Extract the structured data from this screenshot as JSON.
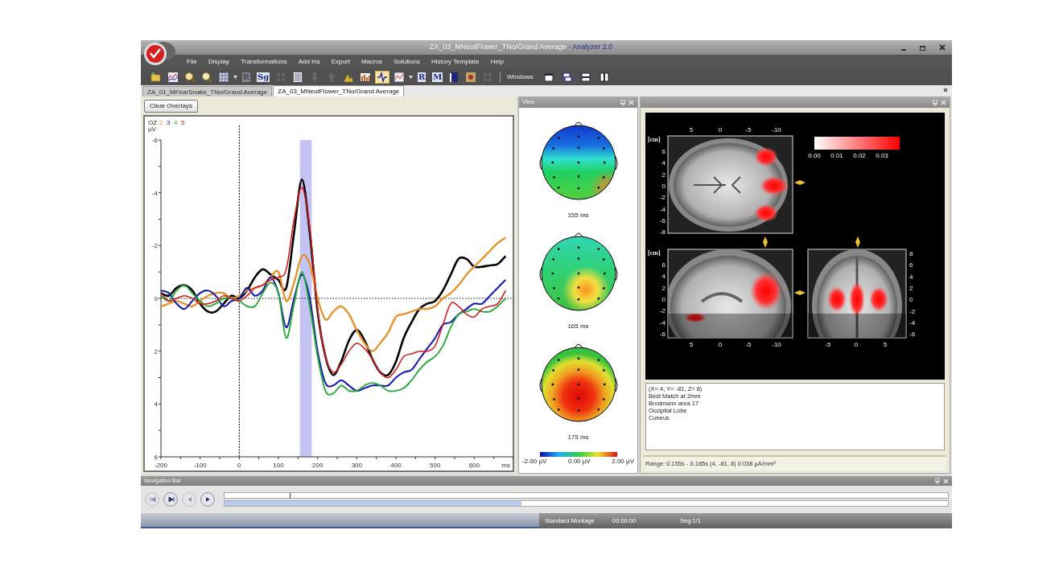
{
  "window": {
    "title": "ZA_03_MNeutFlower_TNo/Grand Average",
    "app_name": " - Analyzer 2.0"
  },
  "menu": [
    "File",
    "Display",
    "Transformations",
    "Add Ins",
    "Export",
    "Macros",
    "Solutions",
    "History Template",
    "Help"
  ],
  "toolbar": {
    "buttons": [
      {
        "disabled": false,
        "selected": false
      },
      {
        "disabled": false,
        "selected": false
      },
      {
        "disabled": false,
        "selected": false
      },
      {
        "disabled": false,
        "selected": false
      },
      {
        "disabled": false,
        "selected": false,
        "dropdown": true
      },
      {
        "disabled": true,
        "selected": false,
        "glyph": "R"
      },
      {
        "disabled": false,
        "selected": false,
        "glyph": "Sg"
      },
      {
        "disabled": true,
        "selected": false
      },
      {
        "disabled": false,
        "selected": false
      },
      {
        "disabled": true,
        "selected": false
      },
      {
        "disabled": true,
        "selected": false
      },
      {
        "disabled": false,
        "selected": false
      },
      {
        "disabled": false,
        "selected": false
      },
      {
        "disabled": false,
        "selected": true
      },
      {
        "disabled": false,
        "selected": false,
        "dropdown": true
      },
      {
        "disabled": false,
        "selected": false,
        "glyph": "R"
      },
      {
        "disabled": false,
        "selected": false,
        "glyph": "M"
      },
      {
        "disabled": false,
        "selected": false
      },
      {
        "disabled": false,
        "selected": false
      },
      {
        "disabled": true,
        "selected": false
      }
    ],
    "windows_label": "Windows"
  },
  "tabs": [
    {
      "label": "ZA_01_MFearSnake_TNo/Grand Average",
      "selected": false
    },
    {
      "label": "ZA_03_MNeutFlower_TNo/Grand Average",
      "selected": true
    }
  ],
  "clear_overlays_button": "Clear Overlays",
  "erp_chart": {
    "chart_data": {
      "type": "line",
      "title": "OZ",
      "xlabel": "ms",
      "ylabel": "µV",
      "bands": [
        {
          "axis": "x",
          "from": 155,
          "to": 185
        }
      ],
      "ref_lines": [
        {
          "axis": "x",
          "value": 0
        },
        {
          "axis": "y",
          "value": 0
        }
      ],
      "x": [
        -200,
        -180,
        -160,
        -140,
        -120,
        -100,
        -80,
        -60,
        -40,
        -20,
        0,
        20,
        40,
        60,
        80,
        100,
        120,
        140,
        160,
        180,
        200,
        220,
        240,
        260,
        280,
        300,
        320,
        340,
        360,
        380,
        400,
        420,
        440,
        460,
        480,
        500,
        520,
        540,
        560,
        580,
        600,
        620,
        640,
        660,
        680
      ],
      "series": [
        {
          "color": "#000000",
          "values": [
            -0.2,
            -0.1,
            -0.4,
            -0.5,
            -0.3,
            0.2,
            0.5,
            0.5,
            0.2,
            -0.1,
            0,
            -0.3,
            -0.8,
            -1.1,
            -0.9,
            -0.7,
            -0.4,
            -2.5,
            -4.5,
            -2.5,
            0.5,
            2.2,
            2.9,
            2.4,
            1.6,
            1.2,
            1.6,
            2.3,
            2.8,
            2.9,
            2.4,
            1.5,
            0.9,
            0.4,
            0.2,
            0.1,
            -0.3,
            -0.9,
            -1.5,
            -1.5,
            -1.2,
            -1.2,
            -1.25,
            -1.3,
            -1.6
          ]
        },
        {
          "name": "2",
          "color": "#e8902a",
          "values": [
            0.3,
            0.2,
            0.1,
            0.2,
            0.3,
            0.1,
            -0.1,
            -0.2,
            -0.2,
            0,
            -0.1,
            -0.3,
            -0.4,
            -0.5,
            -0.8,
            -1.0,
            0.1,
            -0.6,
            -1.6,
            -1.3,
            0.0,
            0.8,
            0.5,
            0.3,
            0.6,
            1.2,
            1.7,
            2.0,
            1.7,
            1.3,
            0.7,
            0.6,
            0.5,
            0.4,
            0.4,
            0.3,
            0.0,
            -0.2,
            -0.5,
            -0.9,
            -1.2,
            -1.5,
            -1.8,
            -2.1,
            -2.3
          ]
        },
        {
          "name": "3",
          "color": "#1a1ab0",
          "values": [
            -0.3,
            -0.2,
            0.2,
            0.4,
            0.1,
            -0.2,
            -0.3,
            -0.1,
            0.3,
            0.1,
            0,
            -0.4,
            -0.1,
            -0.3,
            -0.8,
            -0.2,
            1.1,
            0.0,
            -0.9,
            0.0,
            2.0,
            3.2,
            3.3,
            3.1,
            3.3,
            3.5,
            3.4,
            3.3,
            3.3,
            3.3,
            3.0,
            2.8,
            2.7,
            2.3,
            1.9,
            1.5,
            1.0,
            0.9,
            0.6,
            0.4,
            0.2,
            0.2,
            -0.1,
            -0.4,
            -0.7
          ]
        },
        {
          "name": "4",
          "color": "#22aa33",
          "values": [
            -0.1,
            0.1,
            -0.3,
            -0.5,
            -0.2,
            0.1,
            0.3,
            0.2,
            0,
            0.0,
            0.1,
            0.3,
            0.3,
            -0.2,
            -0.6,
            -0.2,
            1.5,
            0.2,
            -1.0,
            0.3,
            2.2,
            3.5,
            3.6,
            3.3,
            3.5,
            3.5,
            3.3,
            3.2,
            3.3,
            3.5,
            3.5,
            3.4,
            3.1,
            2.7,
            2.4,
            2.2,
            1.8,
            1.1,
            0.6,
            0.5,
            0.4,
            0.5,
            0.5,
            0.3,
            0.0
          ]
        },
        {
          "name": "5",
          "color": "#d42020",
          "values": [
            -0.2,
            0.1,
            0.0,
            -0.1,
            0.0,
            0.2,
            0.2,
            0.1,
            -0.1,
            0.0,
            0.1,
            -0.1,
            -0.4,
            -0.5,
            -0.7,
            -0.8,
            -1.1,
            -3.0,
            -4.2,
            -2.7,
            0.4,
            2.2,
            2.8,
            2.5,
            2.0,
            1.7,
            1.9,
            2.3,
            2.8,
            3.0,
            2.7,
            2.2,
            2.1,
            2.0,
            2.0,
            1.8,
            1.0,
            0.2,
            0.3,
            0.6,
            0.7,
            0.4,
            0.3,
            0.2,
            -0.3
          ]
        }
      ],
      "xlim": [
        -200,
        700
      ],
      "ylim": [
        6,
        -6
      ],
      "xticks": [
        -200,
        -100,
        0,
        100,
        200,
        300,
        400,
        500,
        600
      ],
      "yticks": [
        -6,
        -4,
        -2,
        0,
        2,
        4,
        6
      ]
    }
  },
  "map_view": {
    "title": "View",
    "maps": [
      {
        "label": "155 ms"
      },
      {
        "label": "165 ms"
      },
      {
        "label": "175 ms"
      }
    ],
    "scale_labels": [
      "-2.00 µV",
      "0.00 µV",
      "2.00 µV"
    ]
  },
  "brain_view": {
    "axial": {
      "unit": "[cm]",
      "x_ticks": [
        "5",
        "0",
        "-5",
        "-10"
      ],
      "y_ticks": [
        "6",
        "4",
        "2",
        "0",
        "-2",
        "-4",
        "-6",
        "-8"
      ]
    },
    "sagittal": {
      "unit": "[cm]",
      "x_ticks": [
        "5",
        "0",
        "-5",
        "-10"
      ],
      "y_ticks": [
        "6",
        "4",
        "2",
        "0",
        "-2",
        "-4",
        "-6"
      ]
    },
    "coronal": {
      "x_ticks": [
        "-5",
        "0",
        "5"
      ],
      "y_ticks": [
        "8",
        "6",
        "4",
        "2",
        "0",
        "-2",
        "-4",
        "-6"
      ]
    },
    "scale_labels": [
      "0.00",
      "0.01",
      "0.02",
      "0.03"
    ],
    "info_lines": [
      "(X= 4, Y= -81, Z= 8)",
      "Best Match at 2mm",
      "Brodmann area 17",
      "Occipital Lobe",
      "Cuneus"
    ],
    "status": "Range: 0.155s - 0.185s  (4, -81, 8)  0.038 µA/mm²"
  },
  "navigation": {
    "title": "Navigation Bar",
    "buttons": [
      {
        "disabled": true
      },
      {
        "disabled": false
      },
      {
        "disabled": true
      },
      {
        "disabled": false
      }
    ],
    "overview": {
      "level": 0.09
    },
    "scroll": {
      "level": 0.41
    }
  },
  "status_bar": [
    "Standard Montage",
    "00:00:00",
    "Seg:1/1"
  ]
}
